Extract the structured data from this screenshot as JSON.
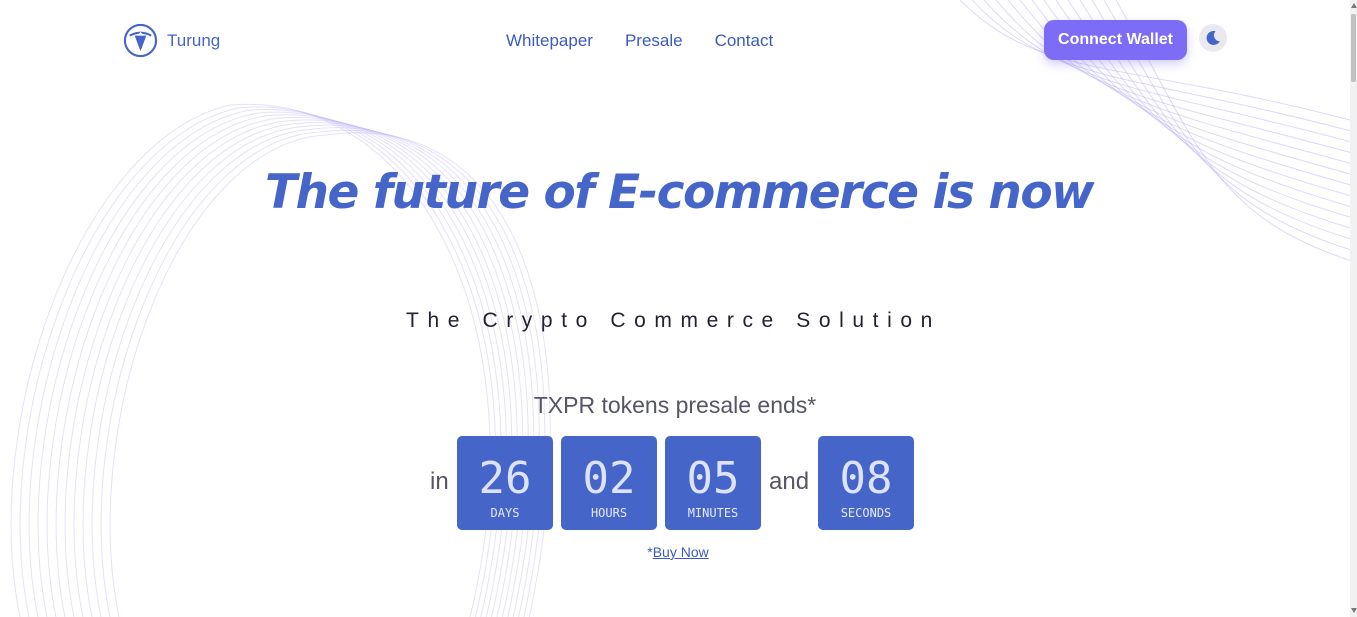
{
  "header": {
    "brand": "Turung",
    "logo_icon": "turung-logo-icon",
    "nav": [
      "Whitepaper",
      "Presale",
      "Contact"
    ],
    "connect_label": "Connect Wallet",
    "theme_icon": "moon-icon"
  },
  "hero": {
    "title": "The future of E-commerce is now",
    "subtitle": "The Crypto Commerce Solution"
  },
  "presale": {
    "text": "TXPR tokens presale ends*",
    "prefix": "in",
    "connector": "and",
    "units": [
      {
        "value": "26",
        "label": "DAYS"
      },
      {
        "value": "02",
        "label": "HOURS"
      },
      {
        "value": "05",
        "label": "MINUTES"
      },
      {
        "value": "08",
        "label": "SECONDS"
      }
    ],
    "footnote_mark": "*",
    "buy_label": "Buy Now"
  },
  "colors": {
    "primary": "#4565c9",
    "accent": "#7c6cf6",
    "wave": "#b3aaf5"
  }
}
